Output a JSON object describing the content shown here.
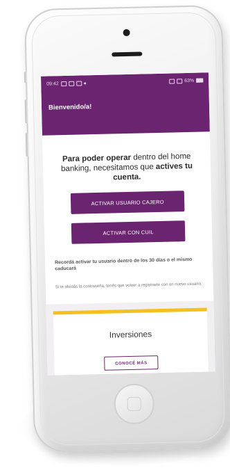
{
  "status_bar": {
    "time": "09:42",
    "right_text": "63%"
  },
  "app_bar": {
    "title": "Bienvenido/a!"
  },
  "intro": {
    "part1": "Para poder operar",
    "part2": " dentro del home banking, necesitamos que ",
    "part3": "actives tu cuenta."
  },
  "buttons": {
    "activate_cashier": "ACTIVAR USUARIO CAJERO",
    "activate_cuil": "ACTIVAR CON CUIL"
  },
  "reminder": "Recordá activar tu usuario dentro de los 30 días o el mismo caducará",
  "note": "Si te olvidás la contraseña, tenés que volver a registrarte con un nuevo usuario.",
  "card": {
    "title": "Inversiones",
    "button": "CONOCÉ MÁS",
    "accent_color": "#f4c020"
  },
  "colors": {
    "brand_purple": "#6b2470"
  }
}
